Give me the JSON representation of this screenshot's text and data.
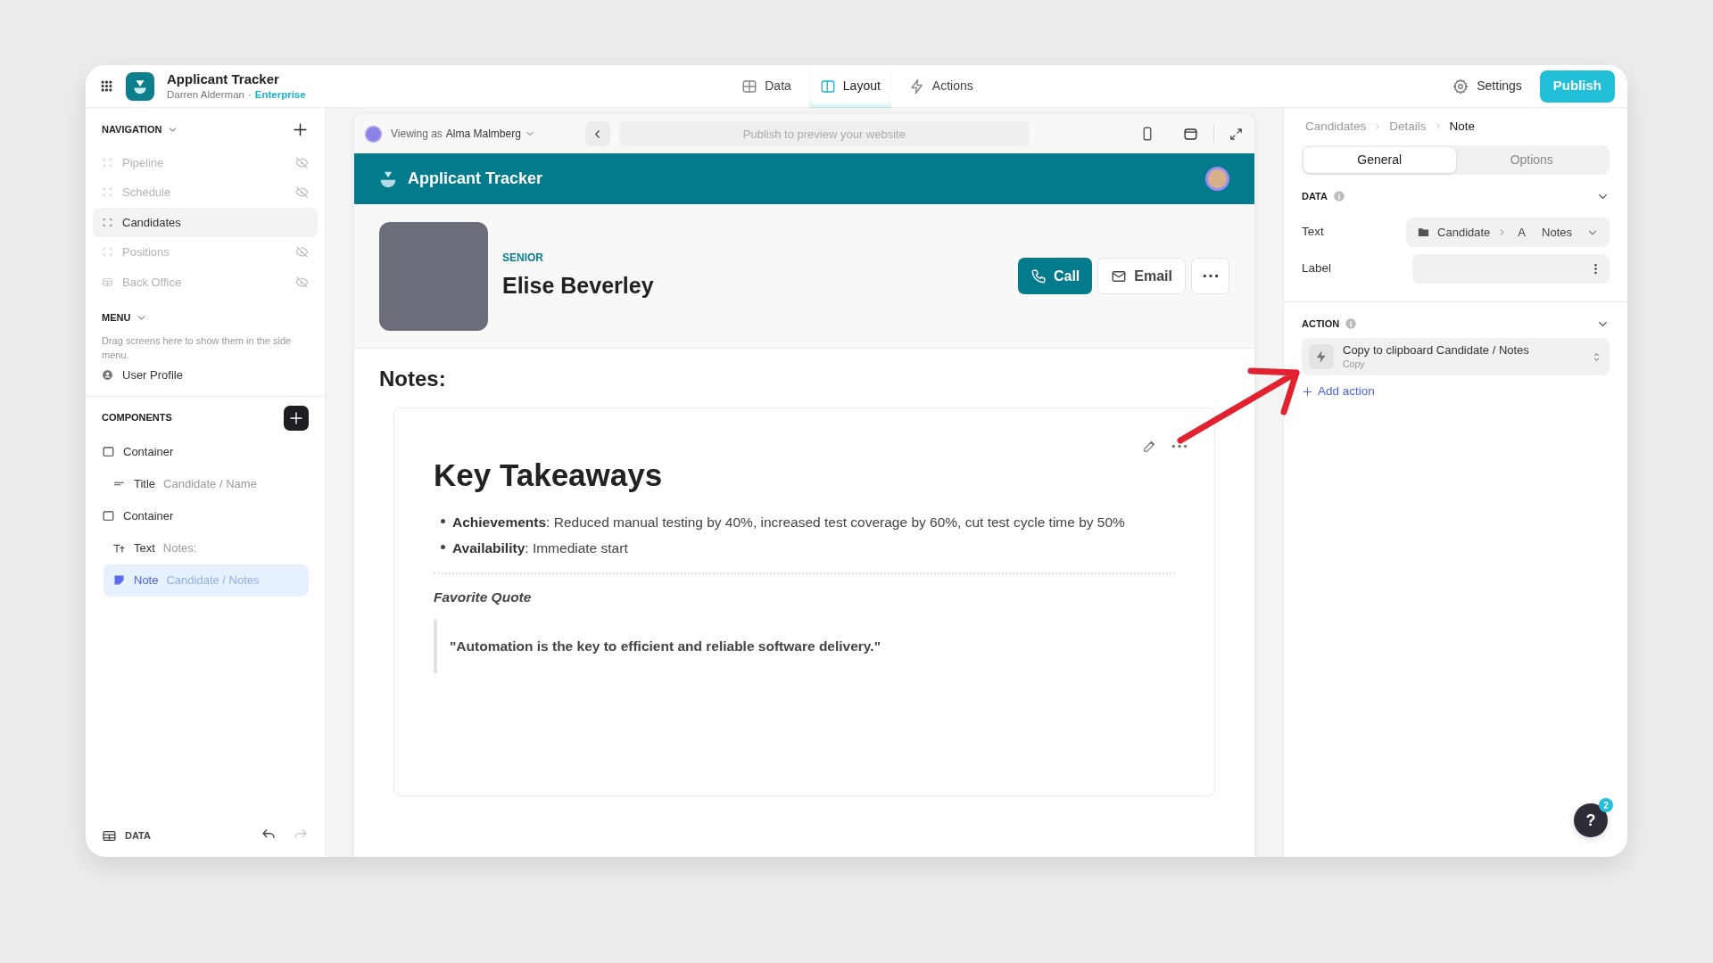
{
  "app": {
    "title": "Applicant Tracker",
    "owner": "Darren Alderman",
    "separator": "·",
    "plan": "Enterprise"
  },
  "top_tabs": [
    {
      "label": "Data",
      "kind": "data",
      "selected": false
    },
    {
      "label": "Layout",
      "kind": "layout",
      "selected": true
    },
    {
      "label": "Actions",
      "kind": "actions",
      "selected": false
    }
  ],
  "settings": "Settings",
  "publish": "Publish",
  "navigation": {
    "title": "NAVIGATION",
    "items": [
      {
        "label": "Pipeline",
        "kind": "screen",
        "hidden": true,
        "selected": false
      },
      {
        "label": "Schedule",
        "kind": "screen",
        "hidden": true,
        "selected": false
      },
      {
        "label": "Candidates",
        "kind": "screen",
        "hidden": false,
        "selected": true
      },
      {
        "label": "Positions",
        "kind": "screen",
        "hidden": true,
        "selected": false
      },
      {
        "label": "Back Office",
        "kind": "table",
        "hidden": true,
        "selected": false
      }
    ]
  },
  "menu": {
    "title": "MENU",
    "hint": "Drag screens here to show them in the side menu.",
    "items": [
      {
        "label": "User Profile"
      }
    ]
  },
  "components": {
    "title": "COMPONENTS",
    "items": [
      {
        "kind": "container",
        "label": "Container",
        "selected": false,
        "children": [
          {
            "kind": "title",
            "label": "Title",
            "binding": "Candidate / Name",
            "selected": false
          }
        ]
      },
      {
        "kind": "container",
        "label": "Container",
        "selected": false,
        "children": [
          {
            "kind": "text",
            "label": "Text",
            "binding": "Notes:",
            "selected": false
          },
          {
            "kind": "note",
            "label": "Note",
            "binding": "Candidate / Notes",
            "selected": true
          }
        ]
      }
    ]
  },
  "footer": {
    "data_label": "DATA"
  },
  "preview": {
    "viewing_prefix": "Viewing as",
    "viewing_user": "Alma Malmberg",
    "url_placeholder": "Publish to preview your website",
    "app_title": "Applicant Tracker",
    "candidate": {
      "level": "SENIOR",
      "name": "Elise Beverley"
    },
    "buttons": [
      {
        "label": "Call",
        "kind": "primary"
      },
      {
        "label": "Email",
        "kind": "secondary"
      }
    ],
    "notes_heading": "Notes:",
    "note": {
      "heading": "Key Takeaways",
      "bullets": [
        "**Achievements**: Reduced manual testing by 40%, increased test coverage by 60%, cut test cycle time by 50%",
        "**Availability**: Immediate start"
      ],
      "quote_heading": "Favorite Quote",
      "quote": "\"Automation is the key to efficient and reliable software delivery.\""
    }
  },
  "inspector": {
    "breadcrumb": [
      "Candidates",
      "Details",
      "Note"
    ],
    "tabs": [
      {
        "label": "General",
        "selected": true
      },
      {
        "label": "Options",
        "selected": false
      }
    ],
    "data_section": {
      "title": "DATA",
      "text_field": {
        "label": "Text",
        "source": "Candidate",
        "type_glyph": "A",
        "value": "Notes"
      },
      "label_field": {
        "label": "Label"
      }
    },
    "action_section": {
      "title": "ACTION",
      "action": {
        "title": "Copy to clipboard Candidate / Notes",
        "subtitle": "Copy"
      },
      "add_action": "Add action"
    }
  },
  "help": {
    "glyph": "?",
    "badge": "2"
  }
}
